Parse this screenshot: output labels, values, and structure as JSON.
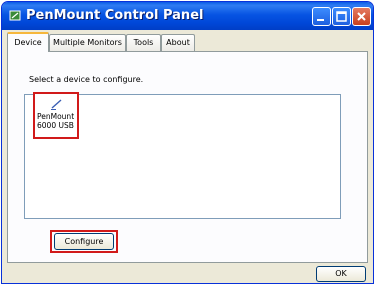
{
  "window": {
    "title": "PenMount Control Panel"
  },
  "tabs": [
    {
      "label": "Device",
      "active": true
    },
    {
      "label": "Multiple Monitors",
      "active": false
    },
    {
      "label": "Tools",
      "active": false
    },
    {
      "label": "About",
      "active": false
    }
  ],
  "device_tab": {
    "instruction": "Select a device to configure.",
    "devices": [
      {
        "line1": "PenMount",
        "line2": "6000 USB",
        "icon": "pen-icon"
      }
    ],
    "configure_label": "Configure"
  },
  "footer": {
    "ok_label": "OK"
  },
  "colors": {
    "titlebar": "#0754e3",
    "highlight": "#d11a1a",
    "face": "#ece9d8"
  }
}
